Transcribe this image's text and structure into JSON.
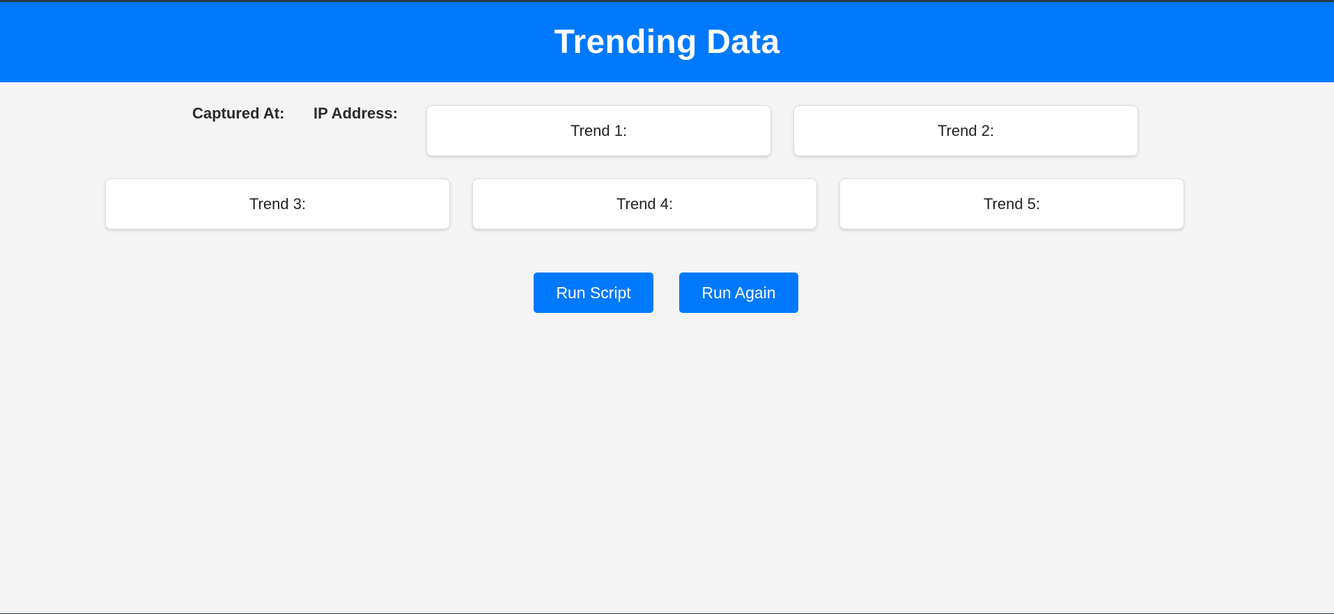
{
  "header": {
    "title": "Trending Data"
  },
  "meta": {
    "captured_at_label": "Captured At:",
    "ip_address_label": "IP Address:"
  },
  "trends": [
    {
      "label": "Trend 1:"
    },
    {
      "label": "Trend 2:"
    },
    {
      "label": "Trend 3:"
    },
    {
      "label": "Trend 4:"
    },
    {
      "label": "Trend 5:"
    }
  ],
  "actions": {
    "run_script_label": "Run Script",
    "run_again_label": "Run Again"
  },
  "colors": {
    "accent": "#0079ff",
    "background": "#f4f4f4",
    "card": "#ffffff"
  }
}
